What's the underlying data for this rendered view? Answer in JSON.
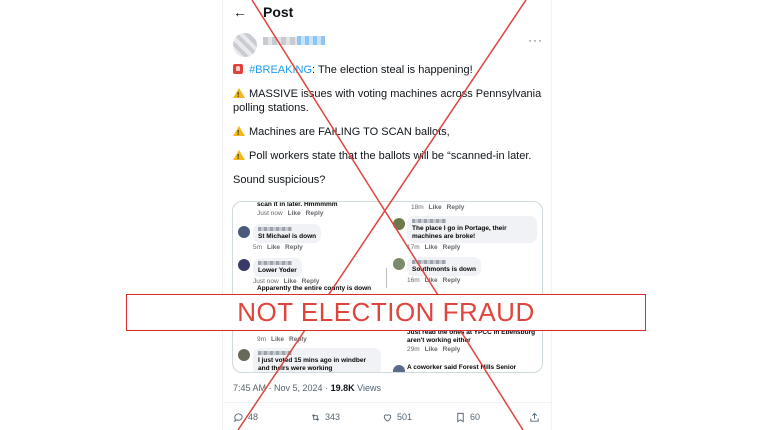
{
  "header": {
    "back_icon": "arrow-left-icon",
    "title": "Post"
  },
  "author": {
    "more_label": "···"
  },
  "tweet": {
    "line1_hashtag": "#BREAKING",
    "line1_rest": ":  The election steal is happening!",
    "line2": "MASSIVE issues with voting machines across Pennsylvania polling stations.",
    "line3": "Machines are FAILING TO SCAN ballots,",
    "line4": "Poll workers state that the ballots will be “scanned-in later.",
    "line5": "Sound suspicious?"
  },
  "media": {
    "left": [
      {
        "text": "scan it in later.  Hmmmmm",
        "time": "Just now",
        "like": "Like",
        "reply": "Reply",
        "avatar_color": ""
      },
      {
        "text": "St Michael is down",
        "time": "5m",
        "like": "Like",
        "reply": "Reply",
        "avatar_color": "#4a5a7a"
      },
      {
        "text": "Lower Yoder",
        "time": "Just now",
        "like": "Like",
        "reply": "Reply",
        "avatar_color": "#3a3a6a"
      },
      {
        "text": "Apparently the entire county is down",
        "time": "",
        "like": "",
        "reply": "",
        "avatar_color": ""
      },
      {
        "text": "",
        "time": "9m",
        "like": "Like",
        "reply": "Reply",
        "avatar_color": ""
      },
      {
        "text": "I just voted 15 mins ago in windber and theirs were working",
        "time": "",
        "like": "",
        "reply": "",
        "avatar_color": "#6a6a5a"
      }
    ],
    "right": [
      {
        "text": "",
        "time": "18m",
        "like": "Like",
        "reply": "Reply",
        "avatar_color": ""
      },
      {
        "text": "The place I go in Portage, their machines are broke!",
        "time": "17m",
        "like": "Like",
        "reply": "Reply",
        "avatar_color": "#6a7a4a"
      },
      {
        "text": "Southmonts is down",
        "time": "16m",
        "like": "Like",
        "reply": "Reply",
        "avatar_color": "#7a8a6a"
      },
      {
        "text": "Just read the ones at YPCC in Ebensburg aren't working either",
        "time": "29m",
        "like": "Like",
        "reply": "Reply",
        "avatar_color": ""
      },
      {
        "text": "A coworker said Forest Hills Senior",
        "time": "",
        "like": "",
        "reply": "",
        "avatar_color": "#5a6a8a"
      }
    ]
  },
  "timeline": {
    "time": "7:45 AM",
    "dot": " · ",
    "date": "Nov 5, 2024",
    "dot2": " · ",
    "views_count": "19.8K",
    "views_label": " Views"
  },
  "actions": {
    "reply_count": "48",
    "repost_count": "343",
    "like_count": "501",
    "bookmark_count": "60",
    "icons": [
      "reply-icon",
      "repost-icon",
      "like-icon",
      "bookmark-icon",
      "share-icon"
    ]
  },
  "stamp": {
    "text": "NOT ELECTION FRAUD",
    "color": "#e0453d"
  },
  "overlay": {
    "x_color": "#e0453d"
  }
}
